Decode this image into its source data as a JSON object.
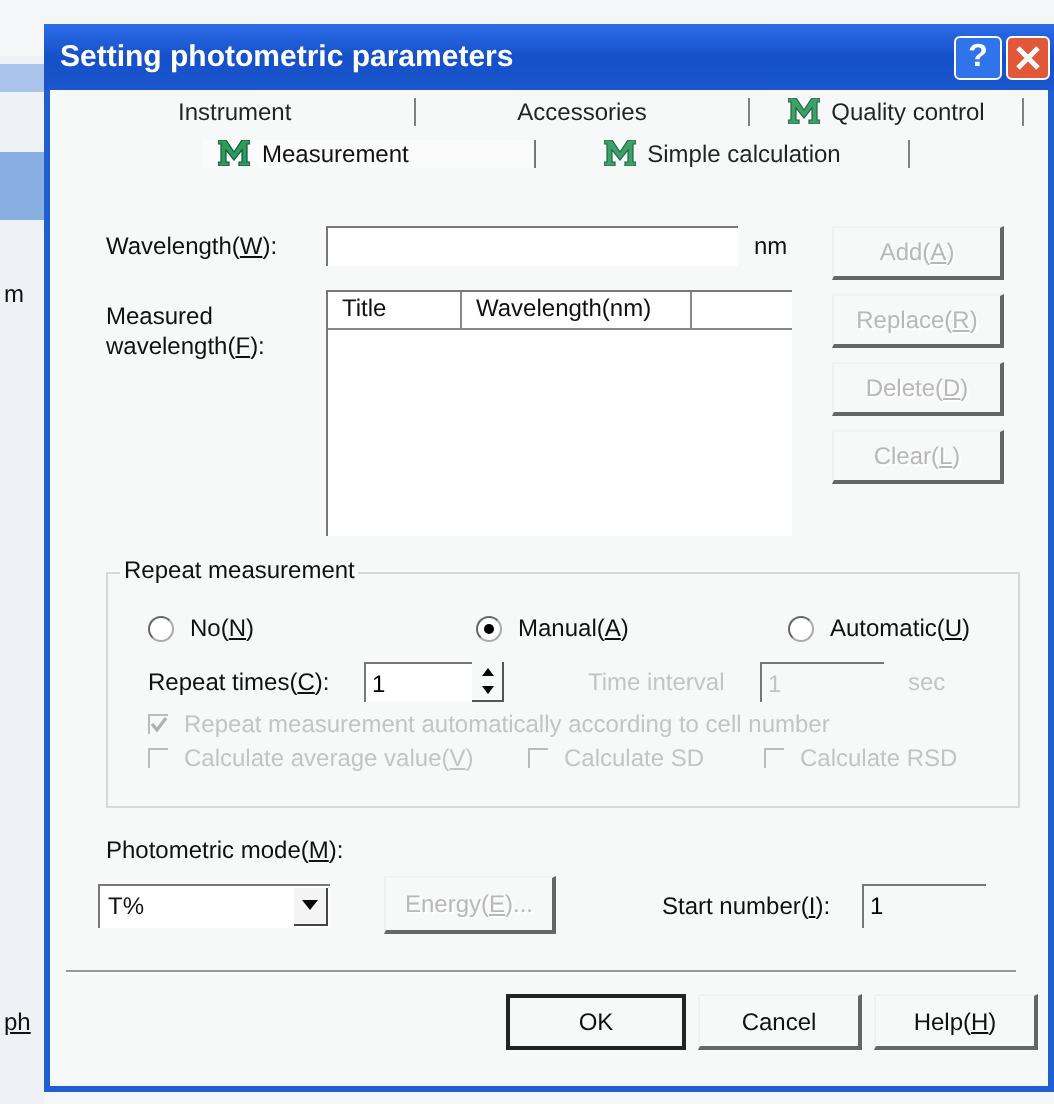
{
  "background": {
    "texts": [
      "m",
      "ph"
    ]
  },
  "window": {
    "title": "Setting photometric parameters",
    "help_glyph": "?"
  },
  "tab_rows": [
    [
      {
        "label": "Instrument",
        "kind": "plain",
        "selected": false
      },
      {
        "label": "Accessories",
        "kind": "plain",
        "selected": false
      },
      {
        "label": "Quality control",
        "kind": "module",
        "selected": false
      }
    ],
    [
      {
        "label": "Measurement",
        "kind": "module",
        "selected": true
      },
      {
        "label": "Simple calculation",
        "kind": "module",
        "selected": false
      }
    ]
  ],
  "wavelength": {
    "label": "Wavelength(W):",
    "unit": "nm"
  },
  "measured": {
    "label": "Measured wavelength(F):",
    "columns": [
      "Title",
      "Wavelength(nm)"
    ]
  },
  "side_buttons": [
    {
      "label": "Add(A)",
      "disabled": true
    },
    {
      "label": "Replace(R)",
      "disabled": true
    },
    {
      "label": "Delete(D)",
      "disabled": true
    },
    {
      "label": "Clear(L)",
      "disabled": true
    }
  ],
  "repeat": {
    "title": "Repeat measurement",
    "options": [
      {
        "label": "No(N)",
        "selected": false
      },
      {
        "label": "Manual(A)",
        "selected": true
      },
      {
        "label": "Automatic(U)",
        "selected": false
      }
    ],
    "times": {
      "label": "Repeat times(C):",
      "value": "1"
    },
    "interval": {
      "label": "Time interval",
      "value": "1",
      "unit": "sec",
      "disabled": true
    },
    "check_rows": [
      [
        {
          "label": "Repeat measurement automatically according to cell number",
          "checked": true,
          "disabled": true
        }
      ],
      [
        {
          "label": "Calculate average value(V)",
          "checked": false,
          "disabled": true
        },
        {
          "label": "Calculate SD",
          "checked": false,
          "disabled": true
        },
        {
          "label": "Calculate RSD",
          "checked": false,
          "disabled": true
        }
      ]
    ]
  },
  "photometric": {
    "label": "Photometric mode(M):",
    "value": "T%",
    "energy": {
      "label": "Energy(E)...",
      "disabled": true
    },
    "start": {
      "label": "Start number(I):",
      "value": "1"
    }
  },
  "footer_buttons": [
    {
      "label": "OK",
      "default": true
    },
    {
      "label": "Cancel",
      "default": false
    },
    {
      "label": "Help(H)",
      "default": false
    }
  ]
}
